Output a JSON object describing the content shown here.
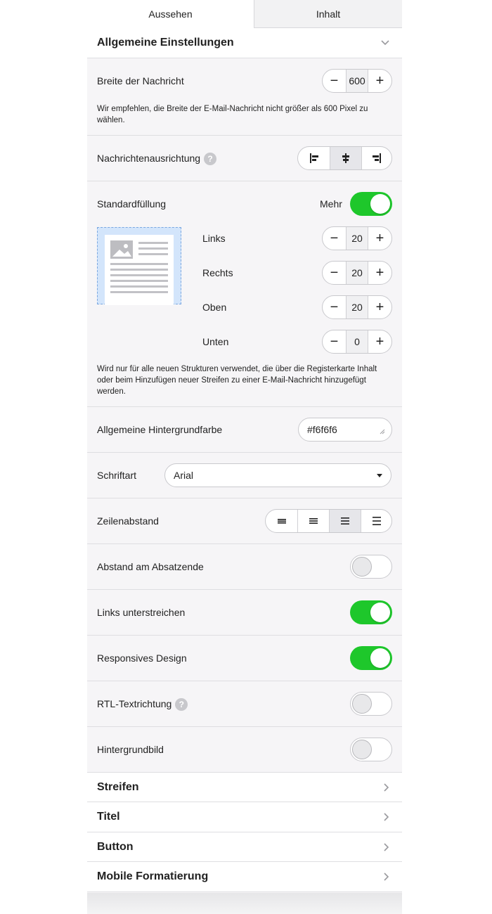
{
  "tabs": [
    {
      "label": "Aussehen",
      "active": true
    },
    {
      "label": "Inhalt",
      "active": false
    }
  ],
  "section": {
    "title": "Allgemeine Einstellungen"
  },
  "width_setting": {
    "label": "Breite der Nachricht",
    "value": "600",
    "note": "Wir empfehlen, die Breite der E-Mail-Nachricht nicht größer als 600 Pixel zu wählen."
  },
  "alignment": {
    "label": "Nachrichtenausrichtung",
    "help": "?",
    "options": [
      "align-left-icon",
      "align-center-icon",
      "align-right-icon"
    ],
    "selected": 1
  },
  "padding": {
    "label": "Standardfüllung",
    "more_label": "Mehr",
    "more_on": true,
    "fields": [
      {
        "label": "Links",
        "value": "20"
      },
      {
        "label": "Rechts",
        "value": "20"
      },
      {
        "label": "Oben",
        "value": "20"
      },
      {
        "label": "Unten",
        "value": "0"
      }
    ],
    "note": "Wird nur für alle neuen Strukturen verwendet, die über die Registerkarte Inhalt oder beim Hinzufügen neuer Streifen zu einer E-Mail-Nachricht hinzugefügt werden."
  },
  "background_color": {
    "label": "Allgemeine Hintergrundfarbe",
    "value": "#f6f6f6"
  },
  "font": {
    "label": "Schriftart",
    "value": "Arial"
  },
  "line_spacing": {
    "label": "Zeilenabstand",
    "selected": 2
  },
  "toggles": [
    {
      "label": "Abstand am Absatzende",
      "on": false,
      "help": false
    },
    {
      "label": "Links unterstreichen",
      "on": true,
      "help": false
    },
    {
      "label": "Responsives Design",
      "on": true,
      "help": false
    },
    {
      "label": "RTL-Textrichtung",
      "on": false,
      "help": true
    },
    {
      "label": "Hintergrundbild",
      "on": false,
      "help": false
    }
  ],
  "help_glyph": "?",
  "collapsed_sections": [
    "Streifen",
    "Titel",
    "Button",
    "Mobile Formatierung"
  ],
  "colors": {
    "accent_green": "#1ec72b",
    "panel_bg": "#f6f5f7",
    "divider": "#dedee1",
    "preview_blue": "#d3e5fb"
  }
}
